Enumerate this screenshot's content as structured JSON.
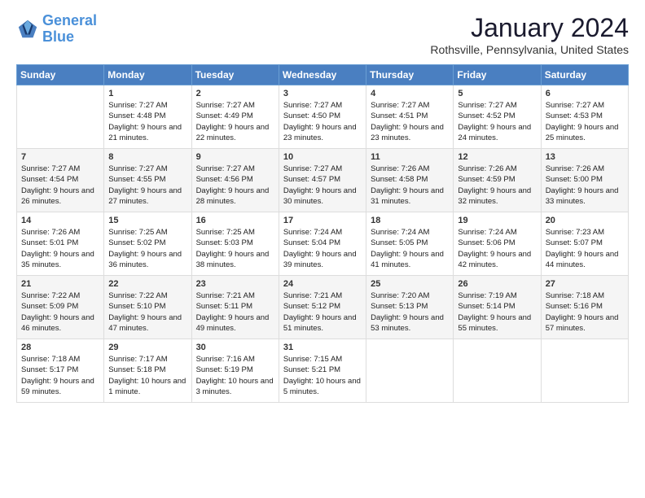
{
  "logo": {
    "line1": "General",
    "line2": "Blue"
  },
  "title": "January 2024",
  "subtitle": "Rothsville, Pennsylvania, United States",
  "columns": [
    "Sunday",
    "Monday",
    "Tuesday",
    "Wednesday",
    "Thursday",
    "Friday",
    "Saturday"
  ],
  "weeks": [
    [
      {
        "day": "",
        "sunrise": "",
        "sunset": "",
        "daylight": ""
      },
      {
        "day": "1",
        "sunrise": "Sunrise: 7:27 AM",
        "sunset": "Sunset: 4:48 PM",
        "daylight": "Daylight: 9 hours and 21 minutes."
      },
      {
        "day": "2",
        "sunrise": "Sunrise: 7:27 AM",
        "sunset": "Sunset: 4:49 PM",
        "daylight": "Daylight: 9 hours and 22 minutes."
      },
      {
        "day": "3",
        "sunrise": "Sunrise: 7:27 AM",
        "sunset": "Sunset: 4:50 PM",
        "daylight": "Daylight: 9 hours and 23 minutes."
      },
      {
        "day": "4",
        "sunrise": "Sunrise: 7:27 AM",
        "sunset": "Sunset: 4:51 PM",
        "daylight": "Daylight: 9 hours and 23 minutes."
      },
      {
        "day": "5",
        "sunrise": "Sunrise: 7:27 AM",
        "sunset": "Sunset: 4:52 PM",
        "daylight": "Daylight: 9 hours and 24 minutes."
      },
      {
        "day": "6",
        "sunrise": "Sunrise: 7:27 AM",
        "sunset": "Sunset: 4:53 PM",
        "daylight": "Daylight: 9 hours and 25 minutes."
      }
    ],
    [
      {
        "day": "7",
        "sunrise": "Sunrise: 7:27 AM",
        "sunset": "Sunset: 4:54 PM",
        "daylight": "Daylight: 9 hours and 26 minutes."
      },
      {
        "day": "8",
        "sunrise": "Sunrise: 7:27 AM",
        "sunset": "Sunset: 4:55 PM",
        "daylight": "Daylight: 9 hours and 27 minutes."
      },
      {
        "day": "9",
        "sunrise": "Sunrise: 7:27 AM",
        "sunset": "Sunset: 4:56 PM",
        "daylight": "Daylight: 9 hours and 28 minutes."
      },
      {
        "day": "10",
        "sunrise": "Sunrise: 7:27 AM",
        "sunset": "Sunset: 4:57 PM",
        "daylight": "Daylight: 9 hours and 30 minutes."
      },
      {
        "day": "11",
        "sunrise": "Sunrise: 7:26 AM",
        "sunset": "Sunset: 4:58 PM",
        "daylight": "Daylight: 9 hours and 31 minutes."
      },
      {
        "day": "12",
        "sunrise": "Sunrise: 7:26 AM",
        "sunset": "Sunset: 4:59 PM",
        "daylight": "Daylight: 9 hours and 32 minutes."
      },
      {
        "day": "13",
        "sunrise": "Sunrise: 7:26 AM",
        "sunset": "Sunset: 5:00 PM",
        "daylight": "Daylight: 9 hours and 33 minutes."
      }
    ],
    [
      {
        "day": "14",
        "sunrise": "Sunrise: 7:26 AM",
        "sunset": "Sunset: 5:01 PM",
        "daylight": "Daylight: 9 hours and 35 minutes."
      },
      {
        "day": "15",
        "sunrise": "Sunrise: 7:25 AM",
        "sunset": "Sunset: 5:02 PM",
        "daylight": "Daylight: 9 hours and 36 minutes."
      },
      {
        "day": "16",
        "sunrise": "Sunrise: 7:25 AM",
        "sunset": "Sunset: 5:03 PM",
        "daylight": "Daylight: 9 hours and 38 minutes."
      },
      {
        "day": "17",
        "sunrise": "Sunrise: 7:24 AM",
        "sunset": "Sunset: 5:04 PM",
        "daylight": "Daylight: 9 hours and 39 minutes."
      },
      {
        "day": "18",
        "sunrise": "Sunrise: 7:24 AM",
        "sunset": "Sunset: 5:05 PM",
        "daylight": "Daylight: 9 hours and 41 minutes."
      },
      {
        "day": "19",
        "sunrise": "Sunrise: 7:24 AM",
        "sunset": "Sunset: 5:06 PM",
        "daylight": "Daylight: 9 hours and 42 minutes."
      },
      {
        "day": "20",
        "sunrise": "Sunrise: 7:23 AM",
        "sunset": "Sunset: 5:07 PM",
        "daylight": "Daylight: 9 hours and 44 minutes."
      }
    ],
    [
      {
        "day": "21",
        "sunrise": "Sunrise: 7:22 AM",
        "sunset": "Sunset: 5:09 PM",
        "daylight": "Daylight: 9 hours and 46 minutes."
      },
      {
        "day": "22",
        "sunrise": "Sunrise: 7:22 AM",
        "sunset": "Sunset: 5:10 PM",
        "daylight": "Daylight: 9 hours and 47 minutes."
      },
      {
        "day": "23",
        "sunrise": "Sunrise: 7:21 AM",
        "sunset": "Sunset: 5:11 PM",
        "daylight": "Daylight: 9 hours and 49 minutes."
      },
      {
        "day": "24",
        "sunrise": "Sunrise: 7:21 AM",
        "sunset": "Sunset: 5:12 PM",
        "daylight": "Daylight: 9 hours and 51 minutes."
      },
      {
        "day": "25",
        "sunrise": "Sunrise: 7:20 AM",
        "sunset": "Sunset: 5:13 PM",
        "daylight": "Daylight: 9 hours and 53 minutes."
      },
      {
        "day": "26",
        "sunrise": "Sunrise: 7:19 AM",
        "sunset": "Sunset: 5:14 PM",
        "daylight": "Daylight: 9 hours and 55 minutes."
      },
      {
        "day": "27",
        "sunrise": "Sunrise: 7:18 AM",
        "sunset": "Sunset: 5:16 PM",
        "daylight": "Daylight: 9 hours and 57 minutes."
      }
    ],
    [
      {
        "day": "28",
        "sunrise": "Sunrise: 7:18 AM",
        "sunset": "Sunset: 5:17 PM",
        "daylight": "Daylight: 9 hours and 59 minutes."
      },
      {
        "day": "29",
        "sunrise": "Sunrise: 7:17 AM",
        "sunset": "Sunset: 5:18 PM",
        "daylight": "Daylight: 10 hours and 1 minute."
      },
      {
        "day": "30",
        "sunrise": "Sunrise: 7:16 AM",
        "sunset": "Sunset: 5:19 PM",
        "daylight": "Daylight: 10 hours and 3 minutes."
      },
      {
        "day": "31",
        "sunrise": "Sunrise: 7:15 AM",
        "sunset": "Sunset: 5:21 PM",
        "daylight": "Daylight: 10 hours and 5 minutes."
      },
      {
        "day": "",
        "sunrise": "",
        "sunset": "",
        "daylight": ""
      },
      {
        "day": "",
        "sunrise": "",
        "sunset": "",
        "daylight": ""
      },
      {
        "day": "",
        "sunrise": "",
        "sunset": "",
        "daylight": ""
      }
    ]
  ]
}
